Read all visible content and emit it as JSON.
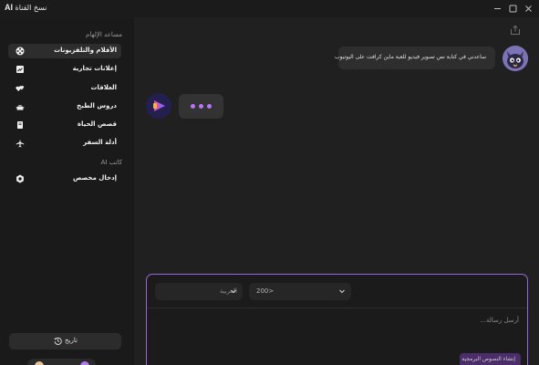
{
  "app": {
    "title_text": "نسخ القناة",
    "title_ai": "AI"
  },
  "sidebar": {
    "section_inspiration": "مساعد الإلهام",
    "items": [
      {
        "label": "الأفلام والتلفزيونات",
        "icon": "film-reel-icon",
        "active": true
      },
      {
        "label": "إعلانات تجارية",
        "icon": "chart-icon",
        "active": false
      },
      {
        "label": "العلاقات",
        "icon": "hearts-icon",
        "active": false
      },
      {
        "label": "دروس الطبخ",
        "icon": "cooking-pot-icon",
        "active": false
      },
      {
        "label": "قصص الحياة",
        "icon": "book-icon",
        "active": false
      },
      {
        "label": "أدلة السفر",
        "icon": "airplane-icon",
        "active": false
      }
    ],
    "section_writer": "كاتب AI",
    "custom_input_label": "إدخال مخصص",
    "history_label": "تاريخ"
  },
  "chat": {
    "user_message": "ساعدني في كتابة نص تصوير فيديو للعبة ماين كرافت على اليوتيوب"
  },
  "composer": {
    "language_value": "العربية",
    "word_count_value": "200>",
    "placeholder": "أرسل رسالة...",
    "generate_label": "إنشاء النصوص البرمجية"
  },
  "colors": {
    "accent": "#b278f5",
    "composer_border": "#9c64d6",
    "generate_button": "#4a2d6a"
  }
}
